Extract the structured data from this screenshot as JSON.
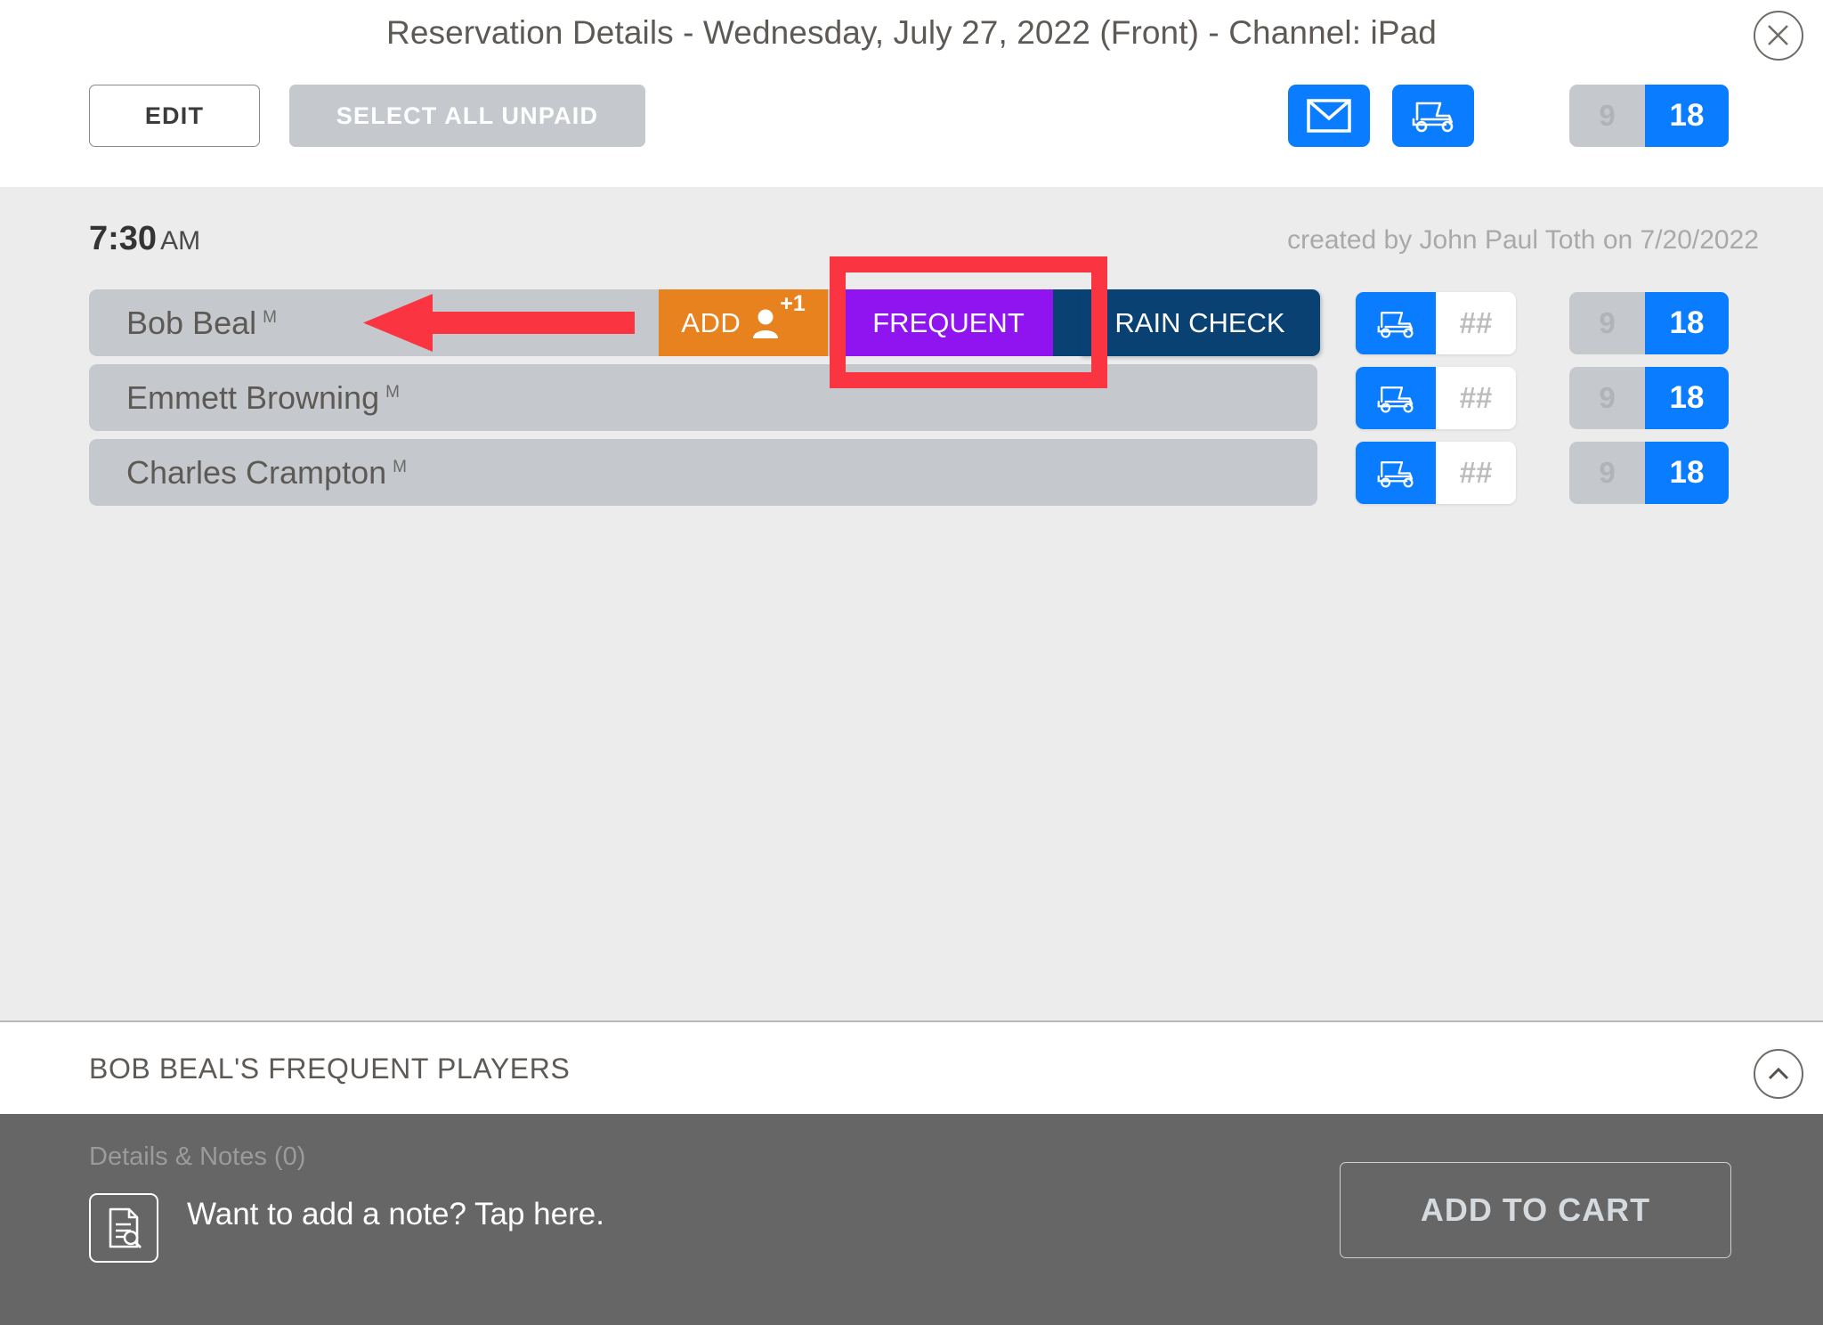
{
  "header": {
    "title": "Reservation Details - Wednesday, July 27, 2022 (Front) - Channel: iPad",
    "close_icon": "close-icon",
    "edit_label": "EDIT",
    "select_all_unpaid_label": "SELECT ALL UNPAID",
    "mail_icon": "envelope-icon",
    "cart_icon": "golf-cart-icon",
    "holes": {
      "nine": "9",
      "eighteen": "18",
      "selected": "18"
    }
  },
  "reservation": {
    "time": "7:30",
    "meridiem": "AM",
    "created_by": "created by John Paul Toth on 7/20/2022"
  },
  "players": [
    {
      "name": "Bob Beal",
      "badge": "M",
      "cart_icon": "golf-cart-icon",
      "cart_number": "##",
      "holes": {
        "nine": "9",
        "eighteen": "18",
        "selected": "18"
      }
    },
    {
      "name": "Emmett Browning",
      "badge": "M",
      "cart_icon": "golf-cart-icon",
      "cart_number": "##",
      "holes": {
        "nine": "9",
        "eighteen": "18",
        "selected": "18"
      }
    },
    {
      "name": "Charles Crampton",
      "badge": "M",
      "cart_icon": "golf-cart-icon",
      "cart_number": "##",
      "holes": {
        "nine": "9",
        "eighteen": "18",
        "selected": "18"
      }
    }
  ],
  "row_actions": {
    "add_label": "ADD",
    "add_person_icon": "person-icon",
    "add_plus": "+1",
    "frequent_label": "FREQUENT",
    "rain_check_label": "RAIN CHECK"
  },
  "frequent_section": {
    "title": "BOB BEAL'S FREQUENT PLAYERS",
    "collapse_icon": "chevron-up-icon"
  },
  "footer": {
    "notes_label": "Details & Notes (0)",
    "note_icon": "document-search-icon",
    "note_prompt": "Want to add a note? Tap here.",
    "add_to_cart_label": "ADD TO CART"
  },
  "annotations": {
    "highlight_target": "FREQUENT",
    "arrow_direction": "left",
    "highlight_color": "#fa3541"
  },
  "colors": {
    "accent_blue": "#0a7cff",
    "orange": "#e8821f",
    "purple": "#8f14f0",
    "navy": "#0a4173",
    "row_grey": "#c5c9ce",
    "page_grey": "#ececec",
    "footer_grey": "#666666"
  }
}
